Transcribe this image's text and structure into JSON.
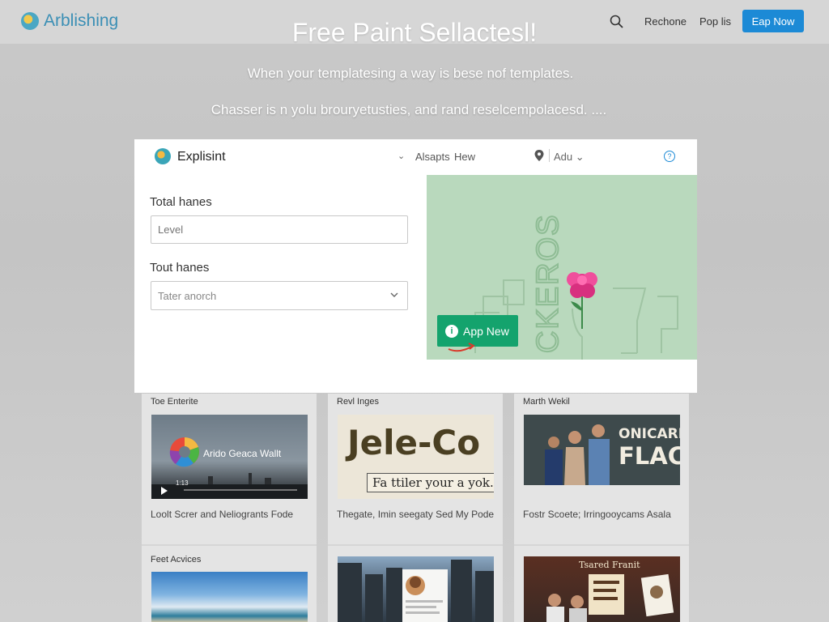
{
  "header": {
    "brand": "Arblishing",
    "links": [
      "Rechone",
      "Pop lis"
    ],
    "cta": "Eap Now"
  },
  "hero": {
    "title": "Free Paint Sellactesl!",
    "line1": "When your templatesing a way is bese nof templates.",
    "line2": "Chasser is n yolu brouryetusties, and rand reselcempolacesd. ...."
  },
  "modal": {
    "brand": "Explisint",
    "nav": [
      "Alsapts",
      "Hew"
    ],
    "language": "Adu",
    "fields": {
      "label1": "Total hanes",
      "input1_placeholder": "Level",
      "label2": "Tout hanes",
      "select_value": "Tater anorch"
    },
    "promo": {
      "art_text": "CKEROS",
      "button": "App New",
      "button_icon": "i"
    }
  },
  "tiles": [
    {
      "head": "Toe Enterite",
      "thumb_overlay": "Arido Geaca Wallt",
      "thumb_time": "1:13",
      "caption": "Loolt Screr and Neliogrants Fode",
      "head2": "Feet Acvices"
    },
    {
      "head": "Revl Inges",
      "thumb_big": "Jele-Co",
      "thumb_tag": "Fa ttiler your a yok.",
      "caption": "Thegate, Imin seegaty Sed My Pode"
    },
    {
      "head": "Marth Wekil",
      "thumb_text1": "ONICARED",
      "thumb_text2": "FLACE",
      "caption": "Fostr Scoete; Irringooycams Asala",
      "thumb2_text": "Tsared Franit"
    }
  ],
  "colors": {
    "accent": "#1c8ad6",
    "promo_bg": "#b9d9bd",
    "promo_button": "#14a36d",
    "brand": "#3b8fb5"
  }
}
